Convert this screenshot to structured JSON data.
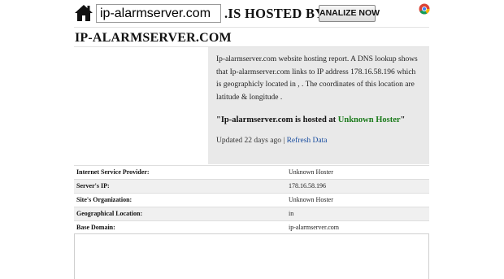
{
  "header": {
    "domain_input_value": "ip-alarmserver.com",
    "hosted_by_text": ".IS HOSTED BY . . .",
    "analyze_button_label": "ANALIZE NOW"
  },
  "page_title": "IP-ALARMSERVER.COM",
  "report": {
    "description": "Ip-alarmserver.com website hosting report. A DNS lookup shows that Ip-alarmserver.com links to IP address 178.16.58.196 which is geographicly located in , . The coordinates of this location are latitude & longitude .",
    "hosted_prefix": "\"Ip-alarmserver.com is hosted at ",
    "hoster_name": "Unknown Hoster",
    "hosted_suffix": "\"",
    "updated_text": "Updated 22 days ago | ",
    "refresh_link": "Refresh Data"
  },
  "info_rows": [
    {
      "label": "Internet Service Provider:",
      "value": "Unknown Hoster"
    },
    {
      "label": "Server's IP:",
      "value": "178.16.58.196"
    },
    {
      "label": "Site's Organization:",
      "value": "Unknown Hoster"
    },
    {
      "label": "Geographical Location:",
      "value": "in"
    },
    {
      "label": "Base Domain:",
      "value": "ip-alarmserver.com"
    }
  ],
  "icons": {
    "home": "home-icon",
    "browser": "chrome-icon"
  }
}
